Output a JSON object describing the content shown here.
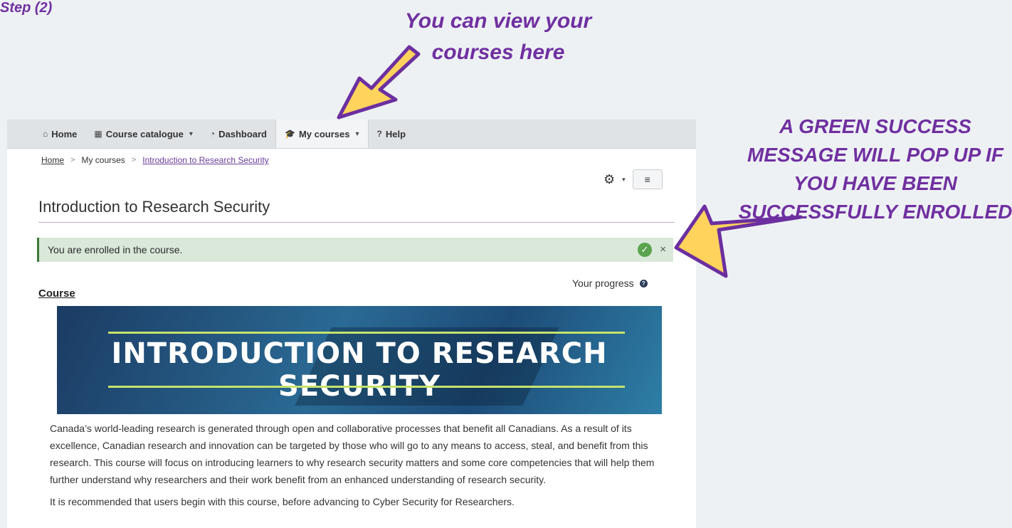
{
  "annotations": {
    "step": "Step (2)",
    "top_callout": "You can view your courses here",
    "right_callout": "A GREEN SUCCESS MESSAGE WILL POP UP IF YOU HAVE BEEN SUCCESSFULLY ENROLLED",
    "color": "#7030a0",
    "arrow_color": "#ffd35c"
  },
  "navbar": {
    "items": [
      {
        "icon": "home-icon",
        "label": "Home"
      },
      {
        "icon": "grid-icon",
        "label": "Course catalogue"
      },
      {
        "icon": "dashboard-icon",
        "label": "Dashboard"
      },
      {
        "icon": "graduation-cap-icon",
        "label": "My courses"
      },
      {
        "icon": "question-icon",
        "label": "Help"
      }
    ]
  },
  "breadcrumb": [
    "Home",
    "My courses",
    "Introduction to Research Security"
  ],
  "page": {
    "title": "Introduction to Research Security",
    "alert": "You are enrolled in the course.",
    "progress_label": "Your progress",
    "section": "Course",
    "banner_title": "INTRODUCTION TO RESEARCH SECURITY",
    "paragraphs": [
      "Canada’s world-leading research is generated through open and collaborative processes that benefit all Canadians. As a result of its excellence, Canadian research and innovation can be targeted by those who will go to any means to access, steal, and benefit from this research. This course will focus on introducing learners to why research security matters and some core competencies that will help them further understand why researchers and their work benefit from an enhanced understanding of research security.",
      "It is recommended that users begin with this course, before advancing to Cyber Security for Researchers."
    ]
  }
}
